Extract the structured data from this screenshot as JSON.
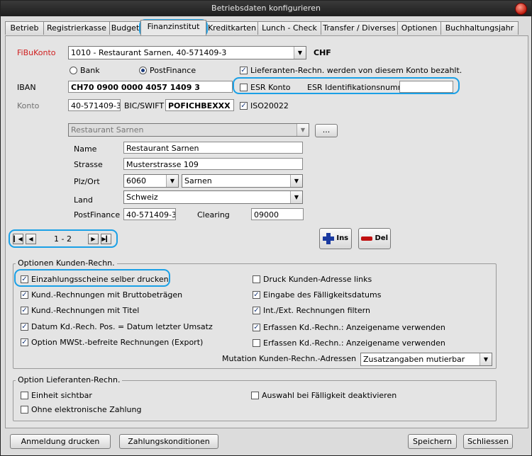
{
  "window": {
    "title": "Betriebsdaten konfigurieren"
  },
  "tabs": [
    "Betrieb",
    "Registrierkasse",
    "Budget",
    "Finanzinstitut",
    "Kreditkarten",
    "Lunch - Check",
    "Transfer / Diverses",
    "Optionen",
    "Buchhaltungsjahr"
  ],
  "active_tab": "Finanzinstitut",
  "fibu": {
    "label": "FiBuKonto",
    "account_value": "1010 - Restaurant Sarnen, 40-571409-3",
    "currency": "CHF",
    "radio_bank": "Bank",
    "radio_postfinance": "PostFinance",
    "selected_radio": "PostFinance",
    "lieferanten_check_label": "Lieferanten-Rechn. werden von diesem Konto bezahlt.",
    "lieferanten_checked": true,
    "iban_label": "IBAN",
    "iban_value": "CH70 0900 0000 4057 1409 3",
    "esr_konto_label": "ESR Konto",
    "esr_konto_checked": false,
    "esr_id_label": "ESR Identifikationsnumm",
    "esr_id_value": "",
    "konto_label": "Konto",
    "konto_value": "40-571409-3",
    "bic_label": "BIC/SWIFT",
    "bic_value": "POFICHBEXXX",
    "iso_label": "ISO20022",
    "iso_checked": true
  },
  "address": {
    "select_value": "Restaurant Sarnen",
    "more_button": "...",
    "name_label": "Name",
    "name_value": "Restaurant Sarnen",
    "strasse_label": "Strasse",
    "strasse_value": "Musterstrasse 109",
    "plzort_label": "Plz/Ort",
    "plz_value": "6060",
    "ort_value": "Sarnen",
    "land_label": "Land",
    "land_value": "Schweiz",
    "postfinance_label": "PostFinance",
    "postfinance_value": "40-571409-3",
    "clearing_label": "Clearing",
    "clearing_value": "09000"
  },
  "navigator": {
    "record_text": "1 - 2"
  },
  "record_buttons": {
    "ins_label": "Ins",
    "del_label": "Del"
  },
  "kunden": {
    "title": "Optionen Kunden-Rechn.",
    "left": [
      {
        "label": "Einzahlungsscheine selber drucken",
        "checked": true
      },
      {
        "label": "Kund.-Rechnungen mit Bruttobeträgen",
        "checked": true
      },
      {
        "label": "Kund.-Rechnungen mit Titel",
        "checked": true
      },
      {
        "label": "Datum Kd.-Rech. Pos. = Datum letzter Umsatz",
        "checked": true
      },
      {
        "label": "Option MWSt.-befreite Rechnungen (Export)",
        "checked": true
      }
    ],
    "right": [
      {
        "label": "Druck Kunden-Adresse links",
        "checked": false
      },
      {
        "label": "Eingabe des Fälligkeitsdatums",
        "checked": true
      },
      {
        "label": "Int./Ext. Rechnungen filtern",
        "checked": true
      },
      {
        "label": "Erfassen Kd.-Rechn.: Anzeigename verwenden",
        "checked": true
      },
      {
        "label": "Erfassen Kd.-Rechn.: Anzeigename verwenden",
        "checked": false
      }
    ],
    "mutation_label": "Mutation Kunden-Rechn.-Adressen",
    "mutation_value": "Zusatzangaben mutierbar"
  },
  "lieferanten": {
    "title": "Option Lieferanten-Rechn.",
    "einheit_label": "Einheit sichtbar",
    "einheit_checked": false,
    "ohne_label": "Ohne elektronische Zahlung",
    "ohne_checked": false,
    "auswahl_label": "Auswahl bei Fälligkeit deaktivieren",
    "auswahl_checked": false
  },
  "footer": {
    "anmeldung_label": "Anmeldung drucken",
    "zahlung_label": "Zahlungskonditionen",
    "speichern_label": "Speichern",
    "schliessen_label": "Schliessen"
  },
  "colors": {
    "highlight": "#1aa0e6",
    "fibu_label": "#d02020",
    "ins_icon": "#1a3aa0",
    "del_icon": "#c01010"
  }
}
